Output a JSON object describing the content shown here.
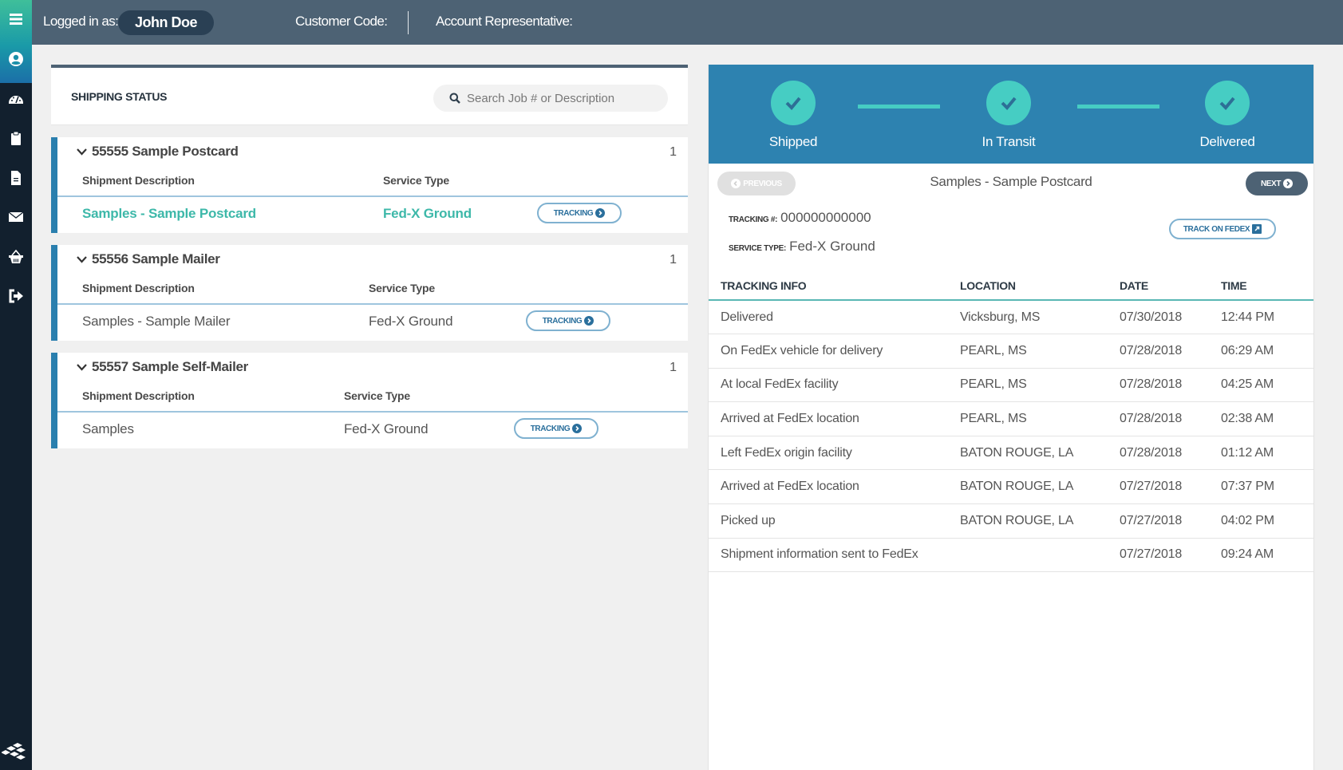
{
  "header": {
    "logged_in_label": "Logged in as:",
    "user_name": "John Doe",
    "customer_code_label": "Customer Code:",
    "account_rep_label": "Account Representative:"
  },
  "sidebar": {
    "items": [
      {
        "icon": "menu-icon"
      },
      {
        "icon": "user-circle-icon"
      },
      {
        "icon": "dashboard-gauge-icon"
      },
      {
        "icon": "clipboard-icon"
      },
      {
        "icon": "document-icon"
      },
      {
        "icon": "envelope-icon"
      },
      {
        "icon": "basket-icon"
      },
      {
        "icon": "sign-out-icon"
      }
    ],
    "logo": "stacked-diamonds-logo"
  },
  "shipping_status": {
    "title": "SHIPPING STATUS",
    "search_placeholder": "Search Job # or Description",
    "col_description": "Shipment Description",
    "col_service": "Service Type",
    "tracking_label": "TRACKING",
    "jobs": [
      {
        "title": "55555 Sample Postcard",
        "count": "1",
        "description": "Samples - Sample Postcard",
        "service": "Fed-X Ground",
        "active": true
      },
      {
        "title": "55556 Sample Mailer",
        "count": "1",
        "description": "Samples - Sample Mailer",
        "service": "Fed-X Ground",
        "active": false
      },
      {
        "title": "55557 Sample Self-Mailer",
        "count": "1",
        "description": "Samples",
        "service": "Fed-X Ground",
        "active": false
      }
    ]
  },
  "tracking_detail": {
    "steps": [
      {
        "label": "Shipped",
        "complete": true
      },
      {
        "label": "In Transit",
        "complete": true
      },
      {
        "label": "Delivered",
        "complete": true
      }
    ],
    "previous_label": "PREVIOUS",
    "next_label": "NEXT",
    "shipment_title": "Samples - Sample Postcard",
    "tracking_number_label": "TRACKING #:",
    "tracking_number": "000000000000",
    "service_type_label": "SERVICE TYPE:",
    "service_type": "Fed-X Ground",
    "track_on_fedex_label": "TRACK ON FEDEX",
    "columns": [
      "TRACKING INFO",
      "LOCATION",
      "DATE",
      "TIME"
    ],
    "events": [
      {
        "info": "Delivered",
        "location": "Vicksburg, MS",
        "date": "07/30/2018",
        "time": "12:44 PM"
      },
      {
        "info": "On FedEx vehicle for delivery",
        "location": "PEARL, MS",
        "date": "07/28/2018",
        "time": "06:29 AM"
      },
      {
        "info": "At local FedEx facility",
        "location": "PEARL, MS",
        "date": "07/28/2018",
        "time": "04:25 AM"
      },
      {
        "info": "Arrived at FedEx location",
        "location": "PEARL, MS",
        "date": "07/28/2018",
        "time": "02:38 AM"
      },
      {
        "info": "Left FedEx origin facility",
        "location": "BATON ROUGE, LA",
        "date": "07/28/2018",
        "time": "01:12 AM"
      },
      {
        "info": "Arrived at FedEx location",
        "location": "BATON ROUGE, LA",
        "date": "07/27/2018",
        "time": "07:37 PM"
      },
      {
        "info": "Picked up",
        "location": "BATON ROUGE, LA",
        "date": "07/27/2018",
        "time": "04:02 PM"
      },
      {
        "info": "Shipment information sent to FedEx",
        "location": "",
        "date": "07/27/2018",
        "time": "09:24 AM"
      }
    ]
  },
  "colors": {
    "header_bg": "#4d6274",
    "sidebar_bg": "#12202e",
    "accent_blue": "#2d82b0",
    "accent_teal": "#46cdc3",
    "active_text": "#3db8a9"
  }
}
